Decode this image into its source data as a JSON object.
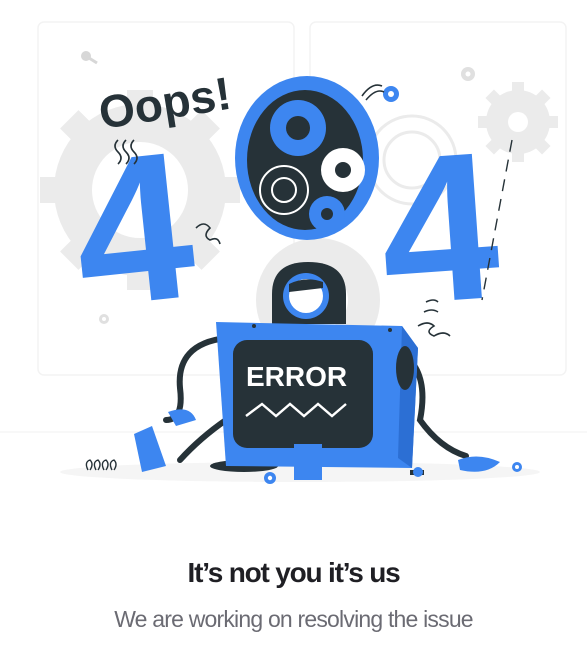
{
  "illustration": {
    "oops_text": "Oops!",
    "digit_left": "4",
    "digit_right": "4",
    "screen_text": "ERROR",
    "accent_color": "#3d86f0",
    "dark_color": "#263238",
    "gear_color": "#ebebeb"
  },
  "message": {
    "headline": "It’s not you it’s us",
    "subline": "We are working on resolving the issue"
  }
}
